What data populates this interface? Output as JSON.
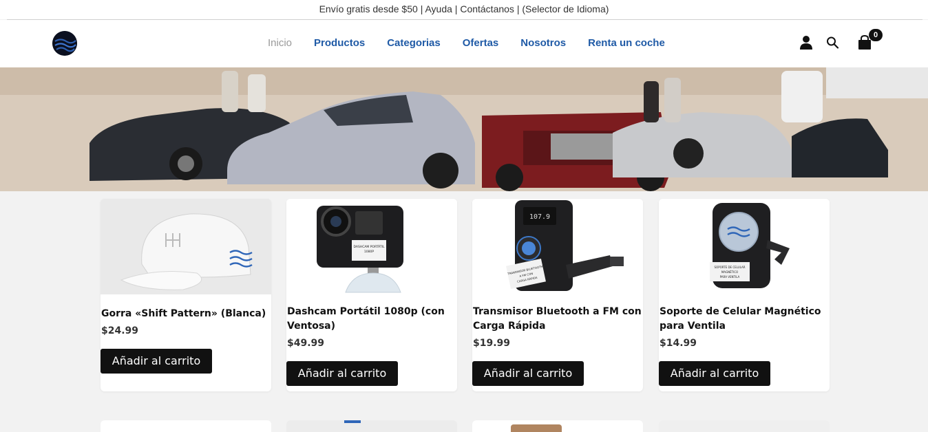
{
  "topbar": {
    "text_shipping": "Envío gratis desde $50",
    "sep": "|",
    "help": "Ayuda",
    "contact": "Contáctanos",
    "lang": "(Selector de Idioma)"
  },
  "nav": {
    "items": [
      {
        "label": "Inicio"
      },
      {
        "label": "Productos"
      },
      {
        "label": "Categorias"
      },
      {
        "label": "Ofertas"
      },
      {
        "label": "Nosotros"
      },
      {
        "label": "Renta un coche"
      }
    ]
  },
  "cart": {
    "count": "0"
  },
  "icons": {
    "user": "user-icon",
    "search": "search-icon",
    "cart": "cart-icon"
  },
  "colors": {
    "nav_link": "#1f5aa6",
    "button": "#111111"
  },
  "products": [
    {
      "title": "Gorra «Shift Pattern» (Blanca)",
      "price": "$24.99",
      "button": "Añadir al carrito"
    },
    {
      "title": "Dashcam Portátil 1080p (con Ventosa)",
      "price": "$49.99",
      "button": "Añadir al carrito"
    },
    {
      "title": "Transmisor Bluetooth a FM con Carga Rápida",
      "price": "$19.99",
      "button": "Añadir al carrito"
    },
    {
      "title": "Soporte de Celular Magnético para Ventila",
      "price": "$14.99",
      "button": "Añadir al carrito"
    }
  ],
  "product_image_text": {
    "dashcam": [
      "DASHCAM PORTÁTIL",
      "1080P"
    ],
    "transmitter": [
      "TRANSMISOR BLUETOOTH",
      "A FM CON",
      "CARGA RÁPIDA"
    ],
    "transmitter_screen": "107.9",
    "holder": [
      "SOPORTE DE CELULAR",
      "MAGNÉTICO",
      "PARA VENTILA"
    ]
  }
}
